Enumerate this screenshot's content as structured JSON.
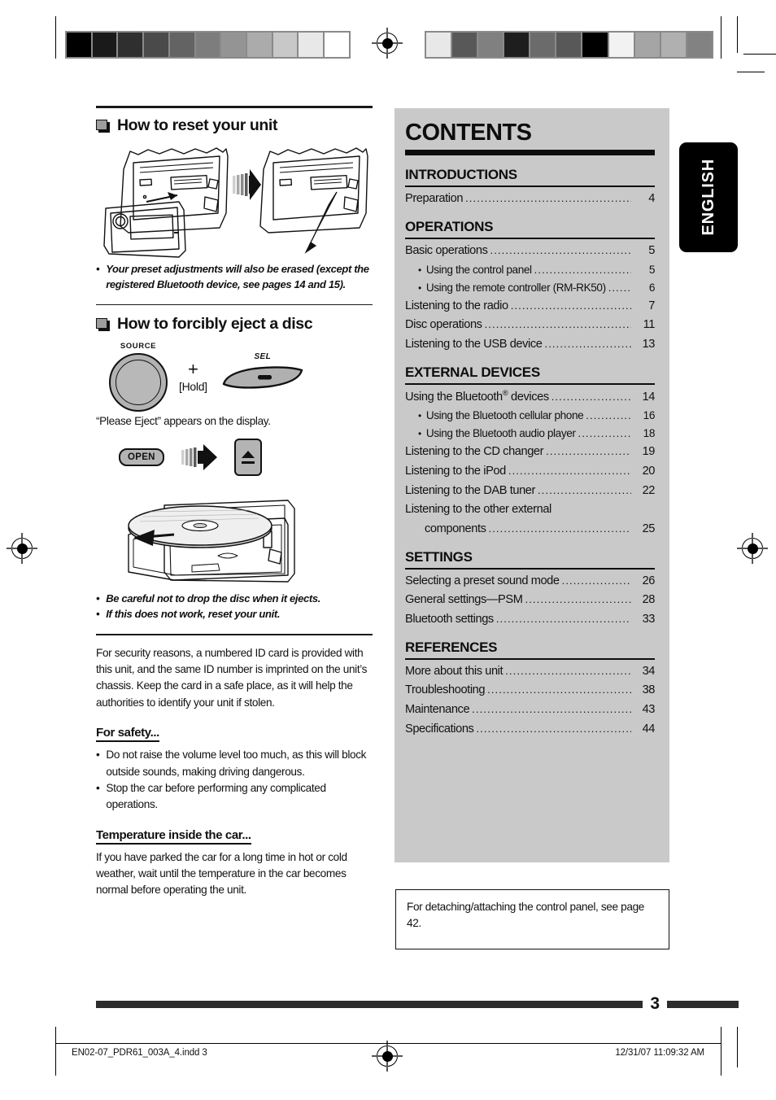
{
  "document": {
    "page_number": "3",
    "language_tab": "ENGLISH",
    "footer_file": "EN02-07_PDR61_003A_4.indd   3",
    "footer_timestamp": "12/31/07   11:09:32 AM"
  },
  "left_column": {
    "section_reset": {
      "heading": "How to reset your unit",
      "note_bullet": "•",
      "note": "Your preset adjustments will also be erased (except the registered Bluetooth device, see pages 14 and 15)."
    },
    "section_eject": {
      "heading": "How to forcibly eject a disc",
      "knob_label": "SOURCE",
      "plus": "+",
      "hold": "[Hold]",
      "sel_label": "SEL",
      "display_text": "“Please Eject” appears on the display.",
      "open_label": "OPEN",
      "notes": [
        "Be careful not to drop the disc when it ejects.",
        "If this does not work, reset your unit."
      ]
    },
    "security_paragraph": "For security reasons, a numbered ID card is provided with this unit, and the same ID number is imprinted on the unit’s chassis. Keep the card in a safe place, as it will help the authorities to identify your unit if stolen.",
    "for_safety": {
      "heading": "For safety...",
      "items": [
        "Do not raise the volume level too much, as this will block outside sounds, making driving dangerous.",
        "Stop the car before performing any complicated operations."
      ]
    },
    "temperature": {
      "heading": "Temperature inside the car...",
      "paragraph": "If you have parked the car for a long time in hot or cold weather, wait until the temperature in the car becomes normal before operating the unit."
    }
  },
  "contents": {
    "title": "CONTENTS",
    "sections": [
      {
        "name": "INTRODUCTIONS",
        "entries": [
          {
            "label": "Preparation",
            "page": "4",
            "sub": false
          }
        ]
      },
      {
        "name": "OPERATIONS",
        "entries": [
          {
            "label": "Basic operations",
            "page": "5",
            "sub": false
          },
          {
            "label": "Using the control panel",
            "page": "5",
            "sub": true
          },
          {
            "label": "Using the remote controller (RM-RK50)",
            "page": "6",
            "sub": true
          },
          {
            "label": "Listening to the radio",
            "page": "7",
            "sub": false
          },
          {
            "label": "Disc operations",
            "page": "11",
            "sub": false
          },
          {
            "label": "Listening to the USB device",
            "page": "13",
            "sub": false
          }
        ]
      },
      {
        "name": "EXTERNAL DEVICES",
        "entries": [
          {
            "label": "Using the Bluetooth® devices",
            "page": "14",
            "sub": false
          },
          {
            "label": "Using the Bluetooth cellular phone",
            "page": "16",
            "sub": true
          },
          {
            "label": "Using the Bluetooth audio player",
            "page": "18",
            "sub": true
          },
          {
            "label": "Listening to the CD changer",
            "page": "19",
            "sub": false
          },
          {
            "label": "Listening to the iPod",
            "page": "20",
            "sub": false
          },
          {
            "label": "Listening to the DAB tuner",
            "page": "22",
            "sub": false
          },
          {
            "label": "Listening to the other external",
            "page": "",
            "sub": false,
            "wrap": true
          },
          {
            "label": "components",
            "page": "25",
            "sub": false,
            "cont": true
          }
        ]
      },
      {
        "name": "SETTINGS",
        "entries": [
          {
            "label": "Selecting a preset sound mode",
            "page": "26",
            "sub": false
          },
          {
            "label": "General settings—PSM",
            "page": "28",
            "sub": false
          },
          {
            "label": "Bluetooth settings",
            "page": "33",
            "sub": false
          }
        ]
      },
      {
        "name": "REFERENCES",
        "entries": [
          {
            "label": "More about this unit",
            "page": "34",
            "sub": false
          },
          {
            "label": "Troubleshooting",
            "page": "38",
            "sub": false
          },
          {
            "label": "Maintenance",
            "page": "43",
            "sub": false
          },
          {
            "label": "Specifications",
            "page": "44",
            "sub": false
          }
        ]
      }
    ]
  },
  "info_box": {
    "text": "For detaching/attaching the control panel, see page 42."
  },
  "calibration": {
    "left_wedge": [
      "#000000",
      "#1a1a1a",
      "#2f2f2f",
      "#4a4a4a",
      "#636363",
      "#7d7d7d",
      "#949494",
      "#ababab",
      "#c8c8c8",
      "#e8e8e8",
      "#ffffff"
    ],
    "right_wedge": [
      "#e8e8e8",
      "#585858",
      "#808080",
      "#1e1e1e",
      "#6b6b6b",
      "#585858",
      "#000000",
      "#f2f2f2",
      "#a5a5a5",
      "#b0b0b0",
      "#828282"
    ]
  }
}
